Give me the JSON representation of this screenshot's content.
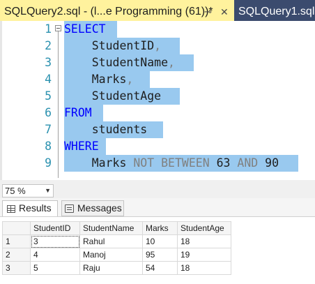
{
  "tabs": {
    "active": {
      "title": "SQLQuery2.sql - (l...e Programming (61))*",
      "pin": "⊸",
      "close": "✕"
    },
    "inactive": {
      "title": "SQLQuery1.sql -"
    }
  },
  "editor": {
    "line_numbers": [
      "1",
      "2",
      "3",
      "4",
      "5",
      "6",
      "7",
      "8",
      "9"
    ],
    "lines": [
      {
        "kw": "SELECT"
      },
      {
        "indent": "    ",
        "text": "StudentID",
        "punct": ","
      },
      {
        "indent": "    ",
        "text": "StudentName",
        "punct": ","
      },
      {
        "indent": "    ",
        "text": "Marks",
        "punct": ","
      },
      {
        "indent": "    ",
        "text": "StudentAge"
      },
      {
        "kw": "FROM"
      },
      {
        "indent": "    ",
        "text": "students"
      },
      {
        "kw": "WHERE"
      },
      {
        "indent": "    ",
        "text": "Marks",
        "op1": "NOT BETWEEN",
        "num1": "63",
        "op2": "AND",
        "num2": "90"
      }
    ]
  },
  "zoom": {
    "value": "75 %",
    "arrow": "▼"
  },
  "result_tabs": {
    "results": "Results",
    "messages": "Messages"
  },
  "grid": {
    "columns": [
      "StudentID",
      "StudentName",
      "Marks",
      "StudentAge"
    ],
    "rows": [
      {
        "num": "1",
        "cells": [
          "3",
          "Rahul",
          "10",
          "18"
        ]
      },
      {
        "num": "2",
        "cells": [
          "4",
          "Manoj",
          "95",
          "19"
        ]
      },
      {
        "num": "3",
        "cells": [
          "5",
          "Raju",
          "54",
          "18"
        ]
      }
    ]
  },
  "colors": {
    "selection": "#99c9ef",
    "keyword": "#0000ff",
    "operator": "#808080",
    "line_number": "#2b91af",
    "active_tab": "#fff29d",
    "tab_bar": "#3b4b6e"
  }
}
